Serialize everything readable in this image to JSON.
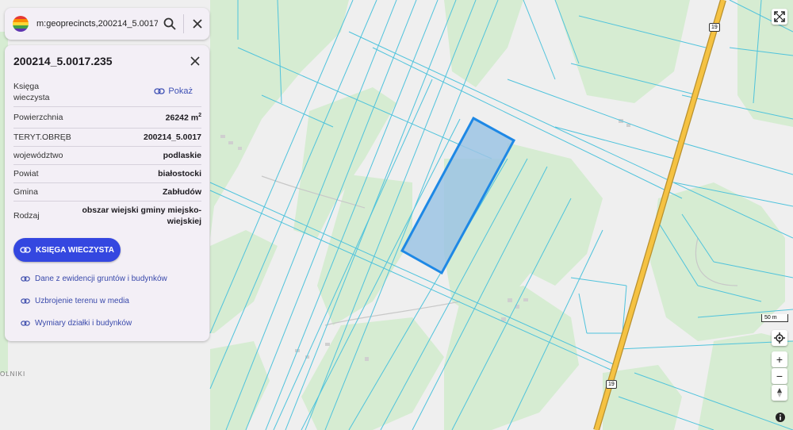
{
  "search": {
    "value": "m:geoprecincts,200214_5.0017"
  },
  "panel": {
    "title": "200214_5.0017.235",
    "rows": [
      {
        "label_line1": "Księga",
        "label_line2": "wieczysta",
        "link": "Pokaż"
      },
      {
        "label": "Powierzchnia",
        "value": "26242 m",
        "value_sup": "2"
      },
      {
        "label": "TERYT.OBRĘB",
        "value": "200214_5.0017"
      },
      {
        "label": "województwo",
        "value": "podlaskie"
      },
      {
        "label": "Powiat",
        "value": "białostocki"
      },
      {
        "label": "Gmina",
        "value": "Zabłudów"
      },
      {
        "label": "Rodzaj",
        "value_line1": "obszar wiejski gminy miejsko-",
        "value_line2": "wiejskiej"
      }
    ],
    "button": "KSIĘGA WIECZYSTA",
    "links": [
      "Dane z ewidencji gruntów i budynków",
      "Uzbrojenie terenu w media",
      "Wymiary działki i budynków"
    ]
  },
  "map": {
    "road_numbers": [
      "19",
      "19"
    ],
    "scale_label": "50 m",
    "place_label": "OLNIKI",
    "highlight_color": "#1e88e5",
    "road_color": "#f5c242",
    "forest_color": "#d6ecd2",
    "parcel_line_color": "#4fc3dc"
  },
  "controls": {
    "fullscreen": "fullscreen-icon",
    "locate": "crosshair-icon",
    "zoom_in": "+",
    "zoom_out": "−",
    "compass": "compass-icon",
    "info": "info-icon"
  }
}
